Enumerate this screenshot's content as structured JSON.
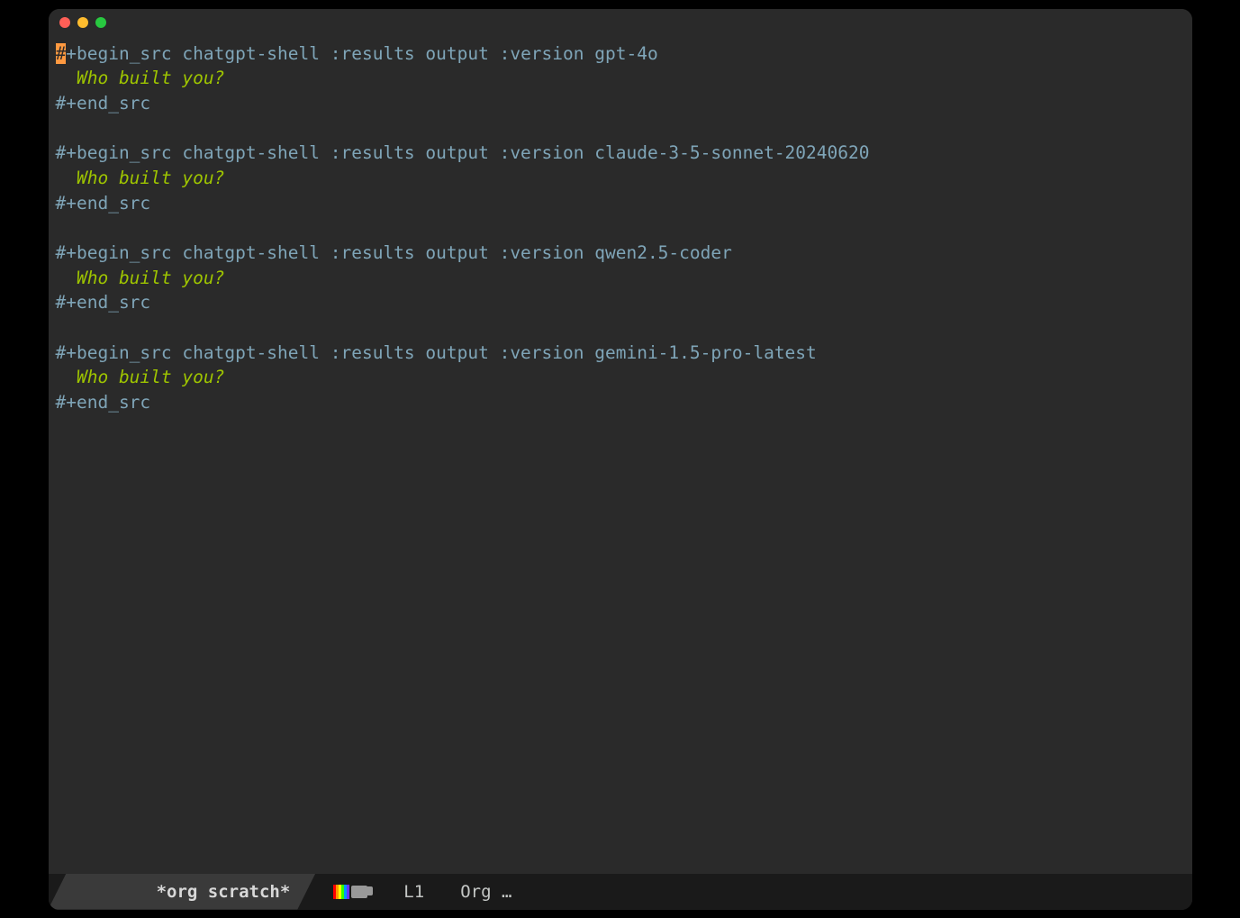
{
  "blocks": [
    {
      "begin": "+begin_src chatgpt-shell :results output :version gpt-4o",
      "body": "  Who built you?",
      "end": "#+end_src"
    },
    {
      "begin": "#+begin_src chatgpt-shell :results output :version claude-3-5-sonnet-20240620",
      "body": "  Who built you?",
      "end": "#+end_src"
    },
    {
      "begin": "#+begin_src chatgpt-shell :results output :version qwen2.5-coder",
      "body": "  Who built you?",
      "end": "#+end_src"
    },
    {
      "begin": "#+begin_src chatgpt-shell :results output :version gemini-1.5-pro-latest",
      "body": "  Who built you?",
      "end": "#+end_src"
    }
  ],
  "cursor_char": "#",
  "modeline": {
    "buffer_name": "*org scratch*",
    "line_indicator": "L1",
    "mode": "Org …"
  }
}
